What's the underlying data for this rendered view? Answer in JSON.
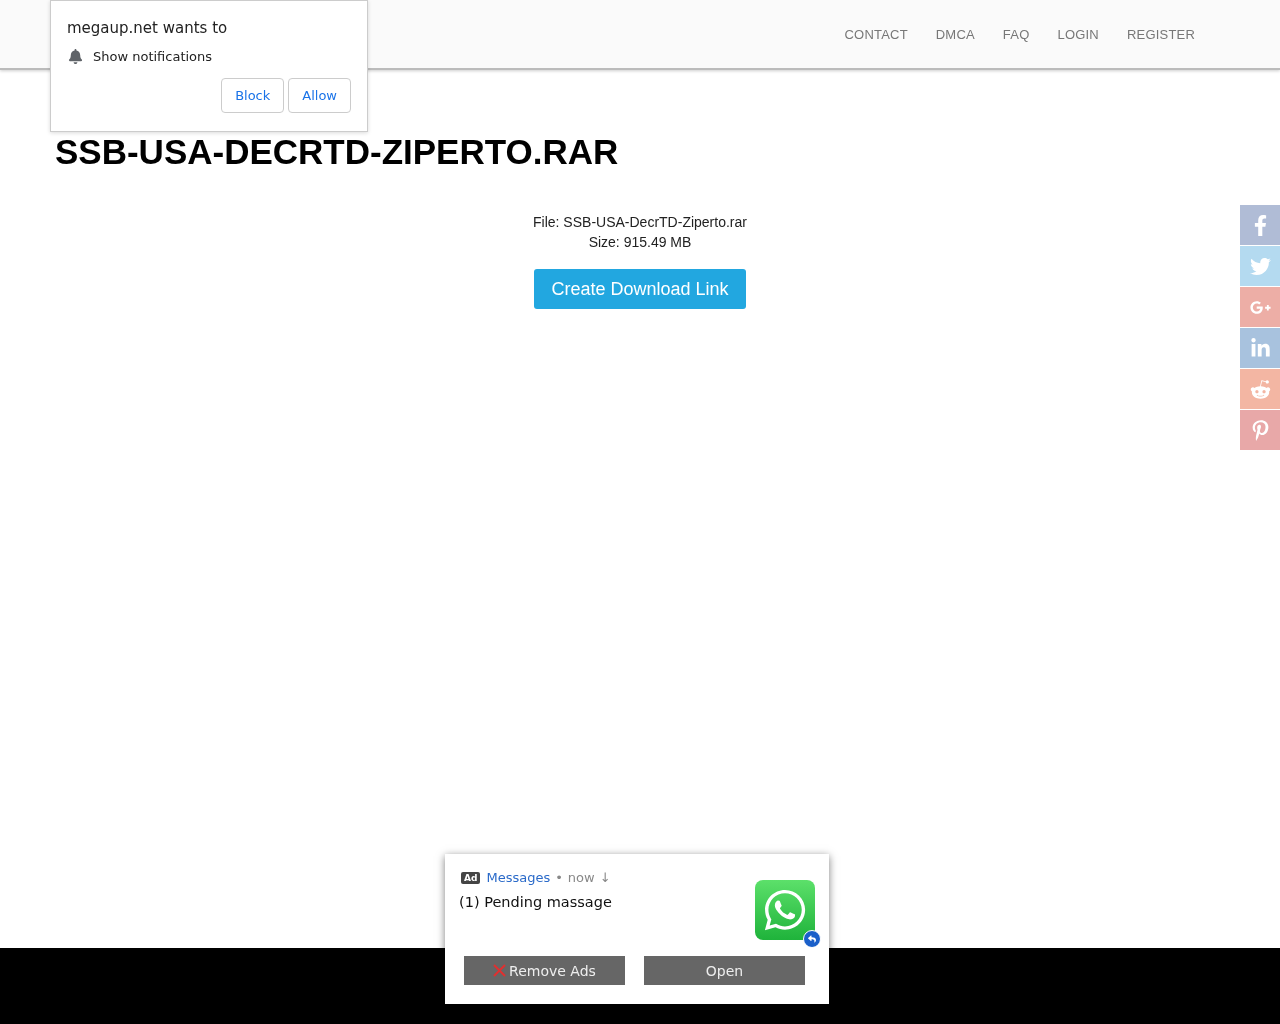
{
  "nav": {
    "links": [
      "CONTACT",
      "DMCA",
      "FAQ",
      "LOGIN",
      "REGISTER"
    ]
  },
  "title": "SSB-USA-DECRTD-ZIPERTO.RAR",
  "file_info": {
    "file": "File: SSB-USA-DecrTD-Ziperto.rar",
    "size": "Size: 915.49 MB",
    "button": "Create Download Link"
  },
  "social": [
    {
      "kind": "facebook",
      "color": "#b0bcd6"
    },
    {
      "kind": "twitter",
      "color": "#b4daf0"
    },
    {
      "kind": "googleplus",
      "color": "#edaea6"
    },
    {
      "kind": "linkedin",
      "color": "#a8c2de"
    },
    {
      "kind": "reddit",
      "color": "#f3b6a3"
    },
    {
      "kind": "pinterest",
      "color": "#e8a8a8"
    }
  ],
  "permission_popup": {
    "title": "megaup.net wants to",
    "permission": "Show notifications",
    "buttons": [
      "Block",
      "Allow"
    ]
  },
  "ad": {
    "badge": "Ad",
    "source": "Messages",
    "separator": "•",
    "time": "now",
    "arrow": "↓",
    "message": "(1) Pending massage",
    "remove_button": "Remove Ads",
    "open_button": "Open"
  }
}
